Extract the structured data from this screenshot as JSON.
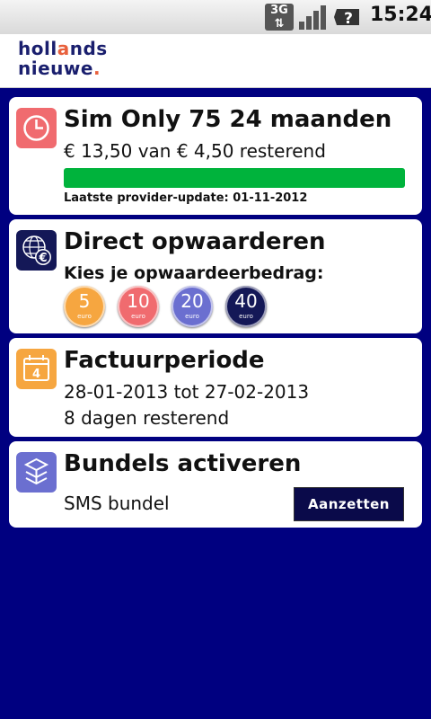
{
  "status_bar": {
    "network": "3G",
    "time": "15:24",
    "icons": [
      "3g-data-icon",
      "signal-icon",
      "help-icon"
    ]
  },
  "header": {
    "logo_line1_a": "holl",
    "logo_line1_o": "a",
    "logo_line1_b": "nds",
    "logo_line2_a": "nieuwe",
    "logo_line2_dot": "."
  },
  "colors": {
    "background": "#000080",
    "progress_green": "#00b33c",
    "coin_5": "#f6a640",
    "coin_10": "#f06b6f",
    "coin_20": "#6b6fd0",
    "coin_40": "#141857"
  },
  "subscription": {
    "title": "Sim Only 75 24 maanden",
    "balance_text": "€ 13,50 van € 4,50 resterend",
    "progress_fraction": 1.0,
    "update_text": "Laatste provider-update: 01-11-2012",
    "icon": "clock-icon"
  },
  "topup": {
    "title": "Direct opwaarderen",
    "prompt": "Kies je opwaardeerbedrag:",
    "icon": "globe-euro-icon",
    "amounts": [
      {
        "value": "5",
        "unit": "euro"
      },
      {
        "value": "10",
        "unit": "euro"
      },
      {
        "value": "20",
        "unit": "euro"
      },
      {
        "value": "40",
        "unit": "euro"
      }
    ]
  },
  "billing": {
    "title": "Factuurperiode",
    "period": "28-01-2013 tot 27-02-2013",
    "remaining": "8 dagen resterend",
    "calendar_day": "4",
    "icon": "calendar-icon"
  },
  "bundles": {
    "title": "Bundels activeren",
    "item_label": "SMS bundel",
    "button_label": "Aanzetten",
    "icon": "bundle-box-icon"
  }
}
